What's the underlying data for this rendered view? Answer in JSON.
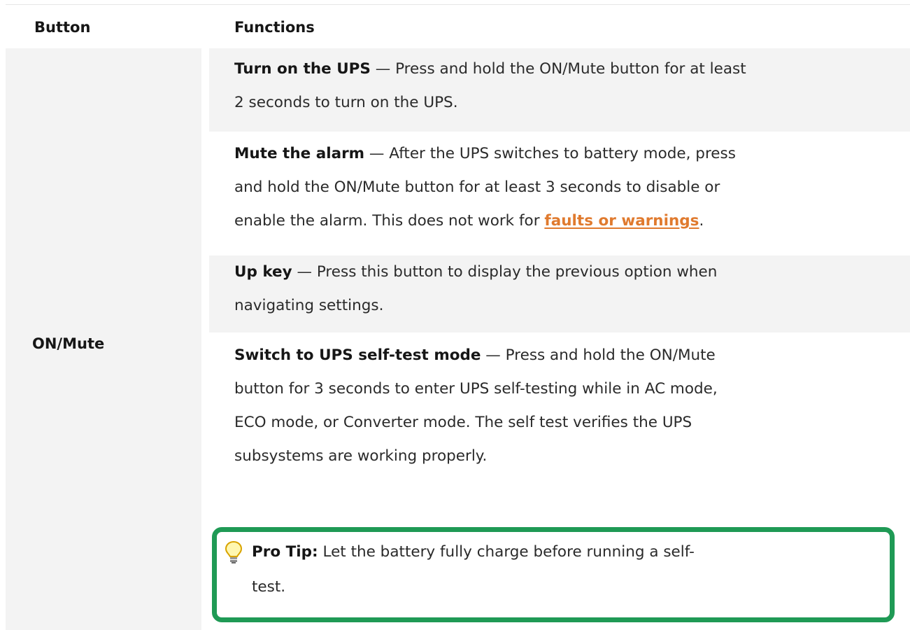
{
  "header": {
    "col_button": "Button",
    "col_functions": "Functions"
  },
  "row": {
    "button_name": "ON/Mute",
    "functions": [
      {
        "title": "Turn on the UPS",
        "dash": " — ",
        "line1": "Press and hold the ON/Mute button for at least",
        "line2": "2 seconds to turn on the UPS."
      },
      {
        "title": "Mute the alarm",
        "dash": " — ",
        "line1": "After the UPS switches to battery mode, press",
        "line2": "and hold the ON/Mute button for at least 3 seconds to disable or",
        "line3_pre": "enable the alarm. This does not work for ",
        "link": "faults or warnings",
        "line3_post": "."
      },
      {
        "title": "Up key",
        "dash": " — ",
        "line1": "Press this button to display the previous option when",
        "line2": "navigating settings."
      },
      {
        "title": "Switch to UPS self-test mode",
        "dash": " — ",
        "line1": "Press and hold the ON/Mute",
        "line2": "button for 3 seconds to enter UPS self-testing while in AC mode,",
        "line3": "ECO mode, or Converter mode. The self test verifies the UPS",
        "line4": "subsystems are working properly."
      }
    ]
  },
  "tip": {
    "label": "Pro Tip:",
    "text_line1": " Let the battery fully charge before running a self-",
    "text_line2": "test.",
    "icon": "lightbulb-icon"
  },
  "colors": {
    "accent_link": "#e07a2e",
    "tip_border": "#1f9a55",
    "row_shade": "#f3f3f3"
  }
}
